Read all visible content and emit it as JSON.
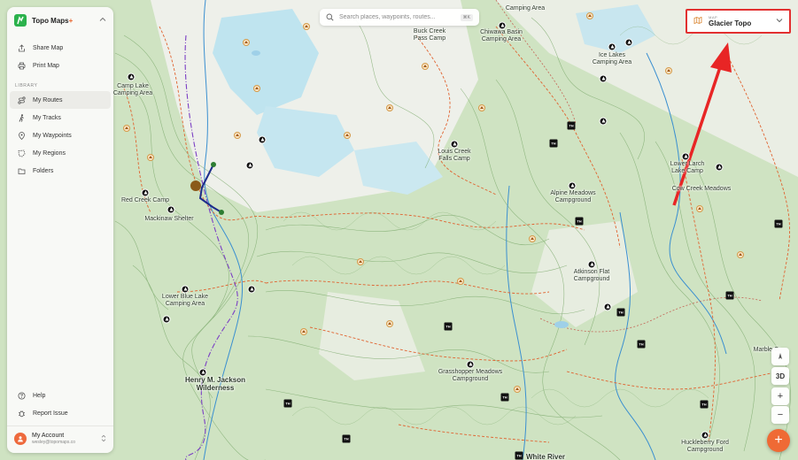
{
  "app": {
    "name": "Topo Maps",
    "name_plus": "+"
  },
  "sidebar": {
    "top_items": [
      {
        "label": "Share Map",
        "icon": "share-icon"
      },
      {
        "label": "Print Map",
        "icon": "printer-icon"
      }
    ],
    "library_heading": "LIBRARY",
    "library_items": [
      {
        "label": "My Routes",
        "icon": "route-icon",
        "active": true
      },
      {
        "label": "My Tracks",
        "icon": "hiker-icon"
      },
      {
        "label": "My Waypoints",
        "icon": "pin-icon"
      },
      {
        "label": "My Regions",
        "icon": "region-icon"
      },
      {
        "label": "Folders",
        "icon": "folder-icon"
      }
    ],
    "bottom_items": [
      {
        "label": "Help",
        "icon": "help-icon"
      },
      {
        "label": "Report Issue",
        "icon": "bug-icon"
      }
    ],
    "account": {
      "name": "My Account",
      "email": "wesley@topomaps.co"
    }
  },
  "search": {
    "placeholder": "Search places, waypoints, routes...",
    "shortcut": "⌘K"
  },
  "map_select": {
    "kicker": "MAP",
    "value": "Glacier Topo"
  },
  "controls": {
    "three_d": "3D",
    "zoom_in": "+",
    "zoom_out": "−",
    "add": "+"
  },
  "map": {
    "labels": {
      "camp_lake": "Camp Lake\nCamping Area",
      "buck_creek": "Buck Creek\nPass Camp",
      "chiwawa": "Chiwawa Basin\nCamping Area",
      "camping_area_top": "Camping Area",
      "ice_lakes": "Ice Lakes\nCamping Area",
      "louis_creek": "Louis Creek\nFalls Camp",
      "lower_larch": "Lower Larch\nLake Camp",
      "cow_creek": "Cow Creek Meadows",
      "red_creek": "Red Creek Camp",
      "mackinaw": "Mackinaw Shelter",
      "alpine_meadows": "Alpine Meadows\nCampground",
      "atkinson": "Atkinson Flat\nCampground",
      "lower_blue": "Lower Blue Lake\nCamping Area",
      "marble": "Marble Cr",
      "grasshopper": "Grasshopper Meadows\nCampground",
      "henry": "Henry M. Jackson\nWilderness",
      "white_river": "White River",
      "huckleberry": "Huckleberry Ford\nCampground"
    },
    "trailhead": "TH",
    "colors": {
      "forest": "#cfe3c2",
      "alpine": "#eef0ea",
      "glacier": "#bfe4ef",
      "contour": "#7aa86a",
      "trail": "#e0622f",
      "route": "#1d2c8a",
      "arrow": "#e82525"
    }
  }
}
